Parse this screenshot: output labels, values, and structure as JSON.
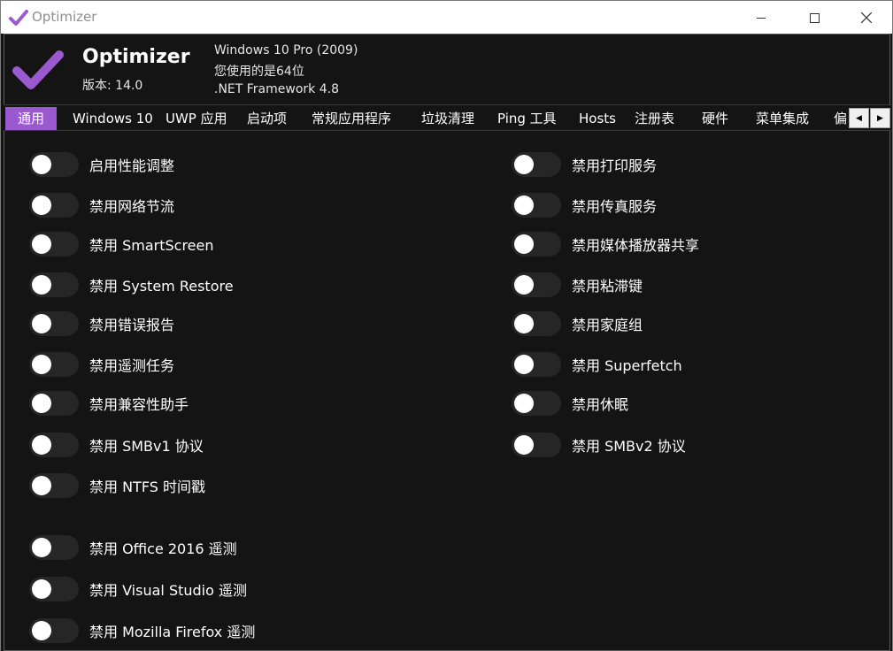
{
  "window": {
    "title": "Optimizer",
    "accent": "#9b59d0"
  },
  "header": {
    "app_name": "Optimizer",
    "version": "版本: 14.0",
    "os": "Windows 10 Pro (2009)",
    "arch": "您使用的是64位",
    "framework": ".NET Framework 4.8"
  },
  "tabs": [
    {
      "label": "通用",
      "active": true
    },
    {
      "label": "Windows 10"
    },
    {
      "label": "UWP 应用"
    },
    {
      "label": "启动项"
    },
    {
      "label": "常规应用程序"
    },
    {
      "label": "垃圾清理"
    },
    {
      "label": "Ping 工具"
    },
    {
      "label": "Hosts"
    },
    {
      "label": "注册表"
    },
    {
      "label": "硬件"
    },
    {
      "label": "菜单集成"
    },
    {
      "label": "偏"
    }
  ],
  "left_options": [
    {
      "label": "启用性能调整",
      "on": false
    },
    {
      "label": "禁用网络节流",
      "on": false
    },
    {
      "label": "禁用 SmartScreen",
      "on": false
    },
    {
      "label": "禁用 System Restore",
      "on": false
    },
    {
      "label": "禁用错误报告",
      "on": false
    },
    {
      "label": "禁用遥测任务",
      "on": false
    },
    {
      "label": "禁用兼容性助手",
      "on": false
    },
    {
      "label": "禁用 SMBv1 协议",
      "on": false
    },
    {
      "label": "禁用 NTFS 时间戳",
      "on": false
    },
    {
      "label": "禁用 Office 2016 遥测",
      "on": false
    },
    {
      "label": "禁用 Visual Studio 遥测",
      "on": false
    },
    {
      "label": "禁用 Mozilla Firefox 遥测",
      "on": false
    }
  ],
  "right_options": [
    {
      "label": "禁用打印服务",
      "on": false
    },
    {
      "label": "禁用传真服务",
      "on": false
    },
    {
      "label": "禁用媒体播放器共享",
      "on": false
    },
    {
      "label": "禁用粘滞键",
      "on": false
    },
    {
      "label": "禁用家庭组",
      "on": false
    },
    {
      "label": "禁用 Superfetch",
      "on": false
    },
    {
      "label": "禁用休眠",
      "on": false
    },
    {
      "label": "禁用 SMBv2 协议",
      "on": false
    }
  ]
}
